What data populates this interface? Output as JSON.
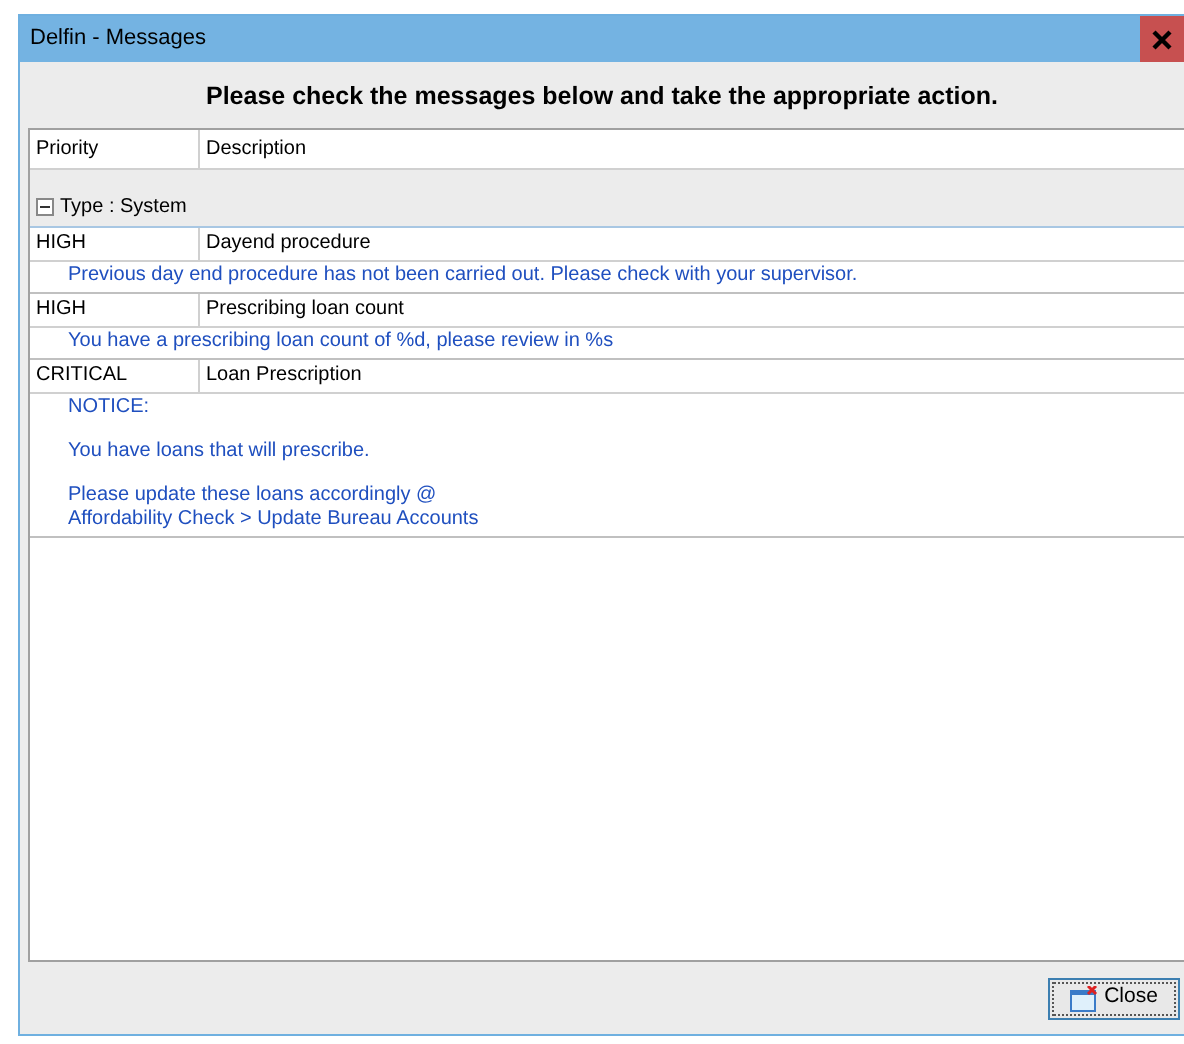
{
  "window": {
    "title": "Delfin - Messages"
  },
  "header": "Please check the messages below and take the appropriate action.",
  "table": {
    "columns": [
      "Priority",
      "Description"
    ],
    "groups": [
      {
        "label": "Type : System",
        "expanded": true,
        "rows": [
          {
            "priority": "HIGH",
            "description": "Dayend procedure",
            "message": [
              "Previous day end procedure has not been carried out. Please check with your supervisor."
            ]
          },
          {
            "priority": "HIGH",
            "description": "Prescribing loan count",
            "message": [
              "You have a prescribing loan count of %d, please review in %s"
            ]
          },
          {
            "priority": "CRITICAL",
            "description": "Loan Prescription",
            "message": [
              "NOTICE:",
              "You have loans that will prescribe.",
              "Please update these loans accordingly @\nAffordability Check > Update Bureau Accounts"
            ]
          }
        ]
      }
    ]
  },
  "buttons": [
    "Close"
  ]
}
